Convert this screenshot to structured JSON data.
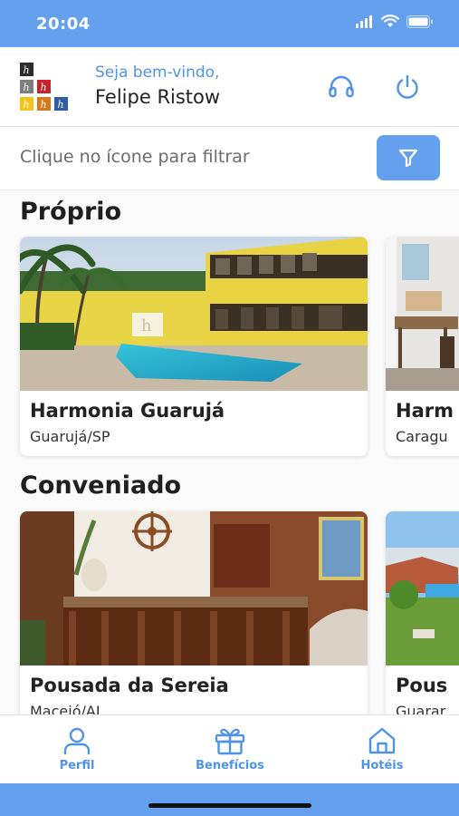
{
  "status": {
    "time": "20:04"
  },
  "header": {
    "logo_text": "h",
    "welcome": "Seja bem-vindo,",
    "user_name": "Felipe Ristow",
    "support_icon": "headset-icon",
    "logout_icon": "power-icon"
  },
  "filter": {
    "placeholder": "Clique no ícone para filtrar",
    "icon": "filter-icon"
  },
  "sections": [
    {
      "title": "Próprio",
      "cards": [
        {
          "name": "Harmonia Guarujá",
          "city": "Guarujá/SP"
        },
        {
          "name": "Harm",
          "city": "Caragu"
        }
      ]
    },
    {
      "title": "Conveniado",
      "cards": [
        {
          "name": "Pousada da Sereia",
          "city": "Maceió/AL"
        },
        {
          "name": "Pous",
          "city": "Guarar"
        }
      ]
    }
  ],
  "nav": {
    "items": [
      {
        "label": "Perfil",
        "icon": "user-icon"
      },
      {
        "label": "Benefícios",
        "icon": "gift-icon"
      },
      {
        "label": "Hotéis",
        "icon": "home-icon"
      }
    ]
  },
  "colors": {
    "primary": "#64a0ee",
    "accent_text": "#4f93e8"
  }
}
